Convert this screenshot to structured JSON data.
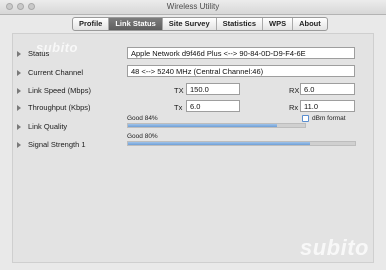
{
  "window": {
    "title": "Wireless Utility"
  },
  "tabs": [
    {
      "label": "Profile"
    },
    {
      "label": "Link Status"
    },
    {
      "label": "Site Survey"
    },
    {
      "label": "Statistics"
    },
    {
      "label": "WPS"
    },
    {
      "label": "About"
    }
  ],
  "active_tab": "Link Status",
  "status": {
    "label": "Status",
    "value": "Apple Network d9f46d Plus <--> 90-84-0D-D9-F4-6E"
  },
  "channel": {
    "label": "Current Channel",
    "value": "48 <--> 5240 MHz (Central Channel:46)"
  },
  "link_speed": {
    "label": "Link Speed (Mbps)",
    "tx_label": "TX",
    "tx_value": "150.0",
    "rx_label": "RX",
    "rx_value": "6.0"
  },
  "throughput": {
    "label": "Throughput (Kbps)",
    "tx_label": "Tx",
    "tx_value": "6.0",
    "rx_label": "Rx",
    "rx_value": "11.0"
  },
  "link_quality": {
    "label": "Link Quality",
    "text": "Good 84%",
    "level_percent": 84
  },
  "dbm_format": {
    "label": "dBm format",
    "checked": false
  },
  "signal_strength": {
    "label": "Signal Strength 1",
    "text": "Good 80%",
    "level_percent": 80
  },
  "watermark": {
    "text": "subito"
  },
  "colors": {
    "active_tab": "#6b6b6b",
    "bar_fill": "#7ea9dd",
    "checkbox_border": "#5b8fd0"
  }
}
